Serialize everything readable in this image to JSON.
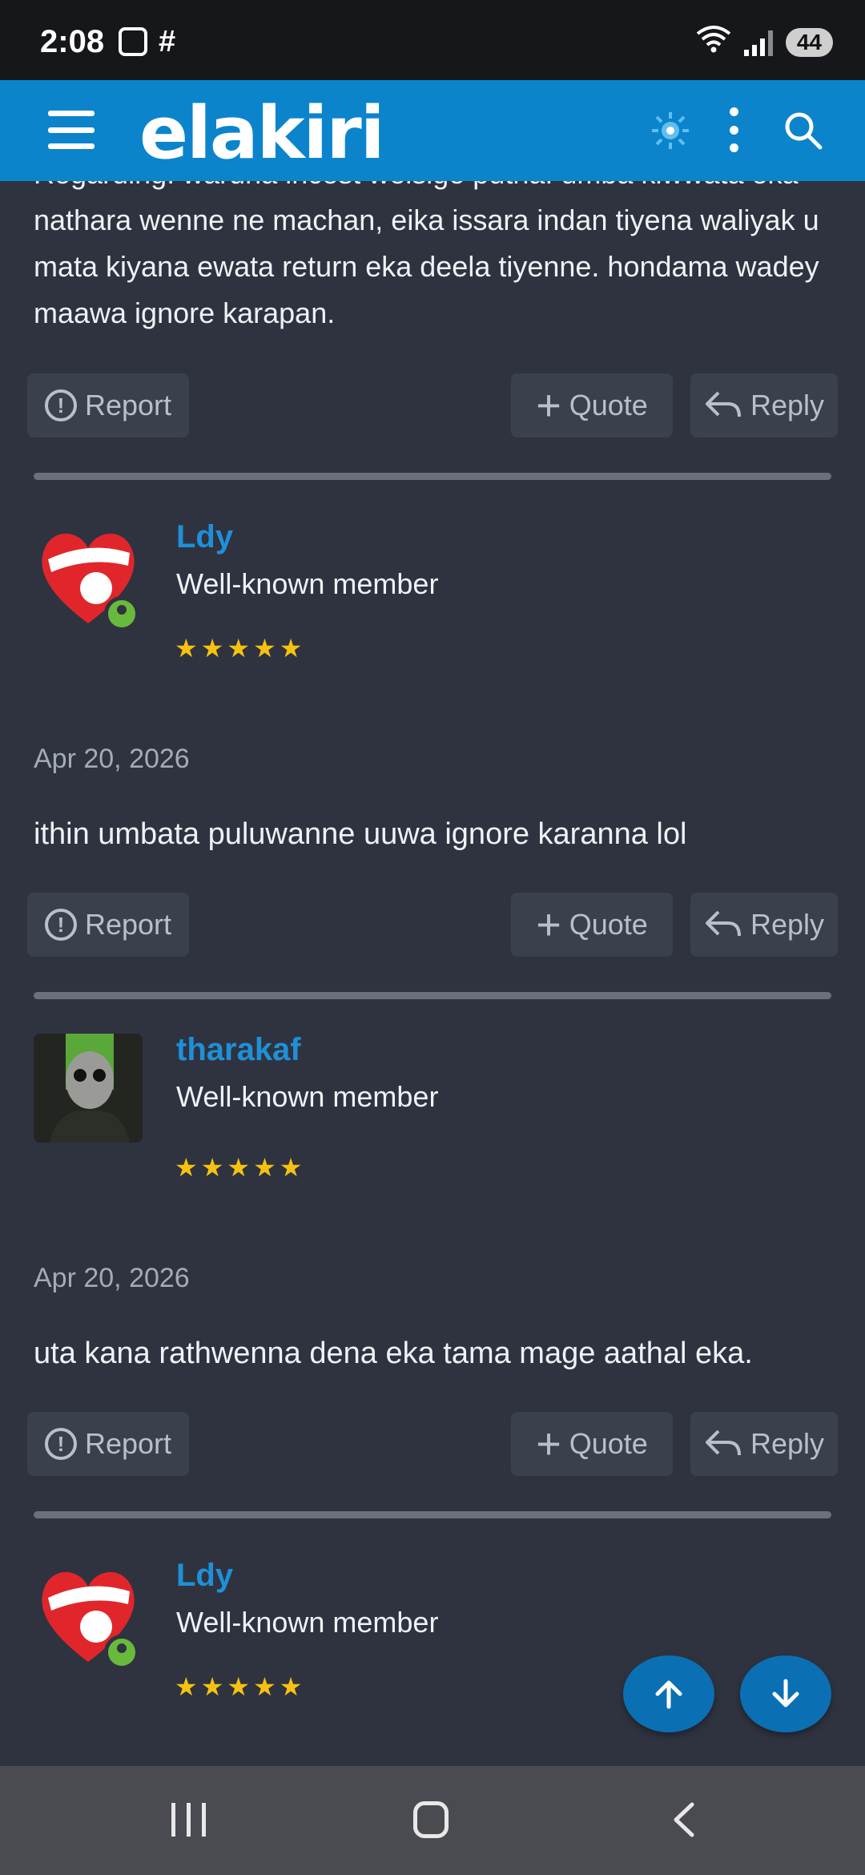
{
  "status_bar": {
    "time": "2:08",
    "battery": "44",
    "left_icons": [
      "screenshot-icon",
      "slack-icon"
    ],
    "right_icons": [
      "wifi-icon",
      "signal-icon",
      "battery-icon"
    ]
  },
  "header": {
    "logo_text": "elakiri",
    "icons": [
      "menu-icon",
      "theme-toggle-icon",
      "more-options-icon",
      "search-icon"
    ]
  },
  "top_post": {
    "text": "Regarding: waruna incest welsige putha: umba kiwwata eka nathara wenne ne machan, eika issara indan tiyena waliyak u mata kiyana ewata return eka deela tiyenne. hondama wadey maawa ignore karapan."
  },
  "actions": {
    "report": "Report",
    "quote": "Quote",
    "reply": "Reply"
  },
  "posts": [
    {
      "username": "Ldy",
      "user_title": "Well-known member",
      "stars": "★★★★★",
      "date": "Apr 20, 2026",
      "body": "ithin umbata puluwanne uuwa ignore karanna lol"
    },
    {
      "username": "tharakaf",
      "user_title": "Well-known member",
      "stars": "★★★★★",
      "date": "Apr 20, 2026",
      "body": "uta kana rathwenna dena eka tama mage aathal eka."
    },
    {
      "username": "Ldy",
      "user_title": "Well-known member",
      "stars": "★★★★★"
    }
  ],
  "colors": {
    "header_bg": "#0b84cc",
    "page_bg": "#2f3340",
    "username": "#1e90d8",
    "star": "#f5c211",
    "online": "#69b93d"
  }
}
